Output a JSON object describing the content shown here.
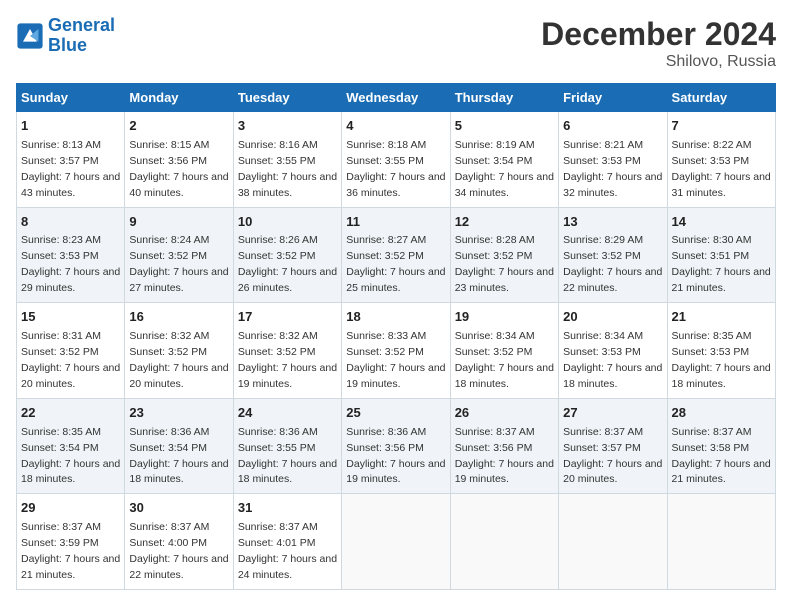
{
  "header": {
    "logo_line1": "General",
    "logo_line2": "Blue",
    "month": "December 2024",
    "location": "Shilovo, Russia"
  },
  "weekdays": [
    "Sunday",
    "Monday",
    "Tuesday",
    "Wednesday",
    "Thursday",
    "Friday",
    "Saturday"
  ],
  "weeks": [
    [
      {
        "day": "1",
        "sunrise": "Sunrise: 8:13 AM",
        "sunset": "Sunset: 3:57 PM",
        "daylight": "Daylight: 7 hours and 43 minutes."
      },
      {
        "day": "2",
        "sunrise": "Sunrise: 8:15 AM",
        "sunset": "Sunset: 3:56 PM",
        "daylight": "Daylight: 7 hours and 40 minutes."
      },
      {
        "day": "3",
        "sunrise": "Sunrise: 8:16 AM",
        "sunset": "Sunset: 3:55 PM",
        "daylight": "Daylight: 7 hours and 38 minutes."
      },
      {
        "day": "4",
        "sunrise": "Sunrise: 8:18 AM",
        "sunset": "Sunset: 3:55 PM",
        "daylight": "Daylight: 7 hours and 36 minutes."
      },
      {
        "day": "5",
        "sunrise": "Sunrise: 8:19 AM",
        "sunset": "Sunset: 3:54 PM",
        "daylight": "Daylight: 7 hours and 34 minutes."
      },
      {
        "day": "6",
        "sunrise": "Sunrise: 8:21 AM",
        "sunset": "Sunset: 3:53 PM",
        "daylight": "Daylight: 7 hours and 32 minutes."
      },
      {
        "day": "7",
        "sunrise": "Sunrise: 8:22 AM",
        "sunset": "Sunset: 3:53 PM",
        "daylight": "Daylight: 7 hours and 31 minutes."
      }
    ],
    [
      {
        "day": "8",
        "sunrise": "Sunrise: 8:23 AM",
        "sunset": "Sunset: 3:53 PM",
        "daylight": "Daylight: 7 hours and 29 minutes."
      },
      {
        "day": "9",
        "sunrise": "Sunrise: 8:24 AM",
        "sunset": "Sunset: 3:52 PM",
        "daylight": "Daylight: 7 hours and 27 minutes."
      },
      {
        "day": "10",
        "sunrise": "Sunrise: 8:26 AM",
        "sunset": "Sunset: 3:52 PM",
        "daylight": "Daylight: 7 hours and 26 minutes."
      },
      {
        "day": "11",
        "sunrise": "Sunrise: 8:27 AM",
        "sunset": "Sunset: 3:52 PM",
        "daylight": "Daylight: 7 hours and 25 minutes."
      },
      {
        "day": "12",
        "sunrise": "Sunrise: 8:28 AM",
        "sunset": "Sunset: 3:52 PM",
        "daylight": "Daylight: 7 hours and 23 minutes."
      },
      {
        "day": "13",
        "sunrise": "Sunrise: 8:29 AM",
        "sunset": "Sunset: 3:52 PM",
        "daylight": "Daylight: 7 hours and 22 minutes."
      },
      {
        "day": "14",
        "sunrise": "Sunrise: 8:30 AM",
        "sunset": "Sunset: 3:51 PM",
        "daylight": "Daylight: 7 hours and 21 minutes."
      }
    ],
    [
      {
        "day": "15",
        "sunrise": "Sunrise: 8:31 AM",
        "sunset": "Sunset: 3:52 PM",
        "daylight": "Daylight: 7 hours and 20 minutes."
      },
      {
        "day": "16",
        "sunrise": "Sunrise: 8:32 AM",
        "sunset": "Sunset: 3:52 PM",
        "daylight": "Daylight: 7 hours and 20 minutes."
      },
      {
        "day": "17",
        "sunrise": "Sunrise: 8:32 AM",
        "sunset": "Sunset: 3:52 PM",
        "daylight": "Daylight: 7 hours and 19 minutes."
      },
      {
        "day": "18",
        "sunrise": "Sunrise: 8:33 AM",
        "sunset": "Sunset: 3:52 PM",
        "daylight": "Daylight: 7 hours and 19 minutes."
      },
      {
        "day": "19",
        "sunrise": "Sunrise: 8:34 AM",
        "sunset": "Sunset: 3:52 PM",
        "daylight": "Daylight: 7 hours and 18 minutes."
      },
      {
        "day": "20",
        "sunrise": "Sunrise: 8:34 AM",
        "sunset": "Sunset: 3:53 PM",
        "daylight": "Daylight: 7 hours and 18 minutes."
      },
      {
        "day": "21",
        "sunrise": "Sunrise: 8:35 AM",
        "sunset": "Sunset: 3:53 PM",
        "daylight": "Daylight: 7 hours and 18 minutes."
      }
    ],
    [
      {
        "day": "22",
        "sunrise": "Sunrise: 8:35 AM",
        "sunset": "Sunset: 3:54 PM",
        "daylight": "Daylight: 7 hours and 18 minutes."
      },
      {
        "day": "23",
        "sunrise": "Sunrise: 8:36 AM",
        "sunset": "Sunset: 3:54 PM",
        "daylight": "Daylight: 7 hours and 18 minutes."
      },
      {
        "day": "24",
        "sunrise": "Sunrise: 8:36 AM",
        "sunset": "Sunset: 3:55 PM",
        "daylight": "Daylight: 7 hours and 18 minutes."
      },
      {
        "day": "25",
        "sunrise": "Sunrise: 8:36 AM",
        "sunset": "Sunset: 3:56 PM",
        "daylight": "Daylight: 7 hours and 19 minutes."
      },
      {
        "day": "26",
        "sunrise": "Sunrise: 8:37 AM",
        "sunset": "Sunset: 3:56 PM",
        "daylight": "Daylight: 7 hours and 19 minutes."
      },
      {
        "day": "27",
        "sunrise": "Sunrise: 8:37 AM",
        "sunset": "Sunset: 3:57 PM",
        "daylight": "Daylight: 7 hours and 20 minutes."
      },
      {
        "day": "28",
        "sunrise": "Sunrise: 8:37 AM",
        "sunset": "Sunset: 3:58 PM",
        "daylight": "Daylight: 7 hours and 21 minutes."
      }
    ],
    [
      {
        "day": "29",
        "sunrise": "Sunrise: 8:37 AM",
        "sunset": "Sunset: 3:59 PM",
        "daylight": "Daylight: 7 hours and 21 minutes."
      },
      {
        "day": "30",
        "sunrise": "Sunrise: 8:37 AM",
        "sunset": "Sunset: 4:00 PM",
        "daylight": "Daylight: 7 hours and 22 minutes."
      },
      {
        "day": "31",
        "sunrise": "Sunrise: 8:37 AM",
        "sunset": "Sunset: 4:01 PM",
        "daylight": "Daylight: 7 hours and 24 minutes."
      },
      null,
      null,
      null,
      null
    ]
  ]
}
